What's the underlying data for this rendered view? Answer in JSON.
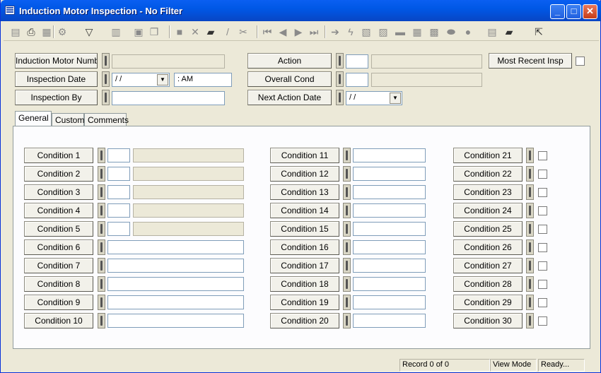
{
  "window": {
    "title": "Induction Motor Inspection - No Filter",
    "minimize": "_",
    "maximize": "□",
    "close": "✕"
  },
  "toolbar": {
    "icons": [
      {
        "name": "record-icon",
        "glyph": "▤",
        "active": false
      },
      {
        "name": "print-icon",
        "glyph": "⎙",
        "active": true
      },
      {
        "name": "preview-icon",
        "glyph": "▦",
        "active": false
      },
      {
        "name": "tools-icon",
        "glyph": "⚙",
        "active": false
      },
      {
        "name": "filter-icon",
        "glyph": "▽",
        "active": true
      },
      {
        "name": "report-icon",
        "glyph": "▥",
        "active": false
      },
      {
        "name": "form-icon",
        "glyph": "▣",
        "active": false
      },
      {
        "name": "copy-icon",
        "glyph": "❐",
        "active": false
      },
      {
        "name": "save-icon",
        "glyph": "■",
        "active": false
      },
      {
        "name": "delete-icon",
        "glyph": "✕",
        "active": false
      },
      {
        "name": "books-icon",
        "glyph": "▰",
        "active": true
      },
      {
        "name": "edit-icon",
        "glyph": "/",
        "active": false
      },
      {
        "name": "cut-icon",
        "glyph": "✂",
        "active": false
      },
      {
        "name": "first-record-icon",
        "glyph": "⏮",
        "active": false
      },
      {
        "name": "previous-record-icon",
        "glyph": "◀",
        "active": false
      },
      {
        "name": "next-record-icon",
        "glyph": "▶",
        "active": false
      },
      {
        "name": "last-record-icon",
        "glyph": "⏭",
        "active": false
      },
      {
        "name": "goto-icon",
        "glyph": "➔",
        "active": false
      },
      {
        "name": "lightning-icon",
        "glyph": "ϟ",
        "active": false
      },
      {
        "name": "tree-icon",
        "glyph": "▧",
        "active": false
      },
      {
        "name": "network-icon",
        "glyph": "▨",
        "active": false
      },
      {
        "name": "grid-icon",
        "glyph": "▬",
        "active": false
      },
      {
        "name": "calendar-icon",
        "glyph": "▦",
        "active": false
      },
      {
        "name": "picture-icon",
        "glyph": "▩",
        "active": false
      },
      {
        "name": "link-icon",
        "glyph": "⬬",
        "active": false
      },
      {
        "name": "search-icon",
        "glyph": "●",
        "active": false
      },
      {
        "name": "keyboard-icon",
        "glyph": "▤",
        "active": false
      },
      {
        "name": "book-icon",
        "glyph": "▰",
        "active": true
      },
      {
        "name": "exit-icon",
        "glyph": "⇱",
        "active": true
      }
    ]
  },
  "header": {
    "motor_number_label": "Induction Motor Number",
    "motor_number_value": "",
    "inspection_date_label": "Inspection Date",
    "inspection_date_value": " /  /",
    "inspection_time_value": "  :  AM",
    "inspection_by_label": "Inspection By",
    "inspection_by_value": "",
    "action_label": "Action",
    "overall_cond_label": "Overall Cond",
    "next_action_date_label": "Next Action Date",
    "next_action_date_value": " /  /",
    "most_recent_label": "Most Recent Insp"
  },
  "tabs": [
    "General",
    "Custom",
    "Comments"
  ],
  "conditions": [
    "Condition 1",
    "Condition 2",
    "Condition 3",
    "Condition 4",
    "Condition 5",
    "Condition 6",
    "Condition 7",
    "Condition 8",
    "Condition 9",
    "Condition 10",
    "Condition 11",
    "Condition 12",
    "Condition 13",
    "Condition 14",
    "Condition 15",
    "Condition 16",
    "Condition 17",
    "Condition 18",
    "Condition 19",
    "Condition 20",
    "Condition 21",
    "Condition 22",
    "Condition 23",
    "Condition 24",
    "Condition 25",
    "Condition 26",
    "Condition 27",
    "Condition 28",
    "Condition 29",
    "Condition 30"
  ],
  "status": {
    "record": "Record 0 of 0",
    "mode": "View Mode",
    "state": "Ready..."
  }
}
